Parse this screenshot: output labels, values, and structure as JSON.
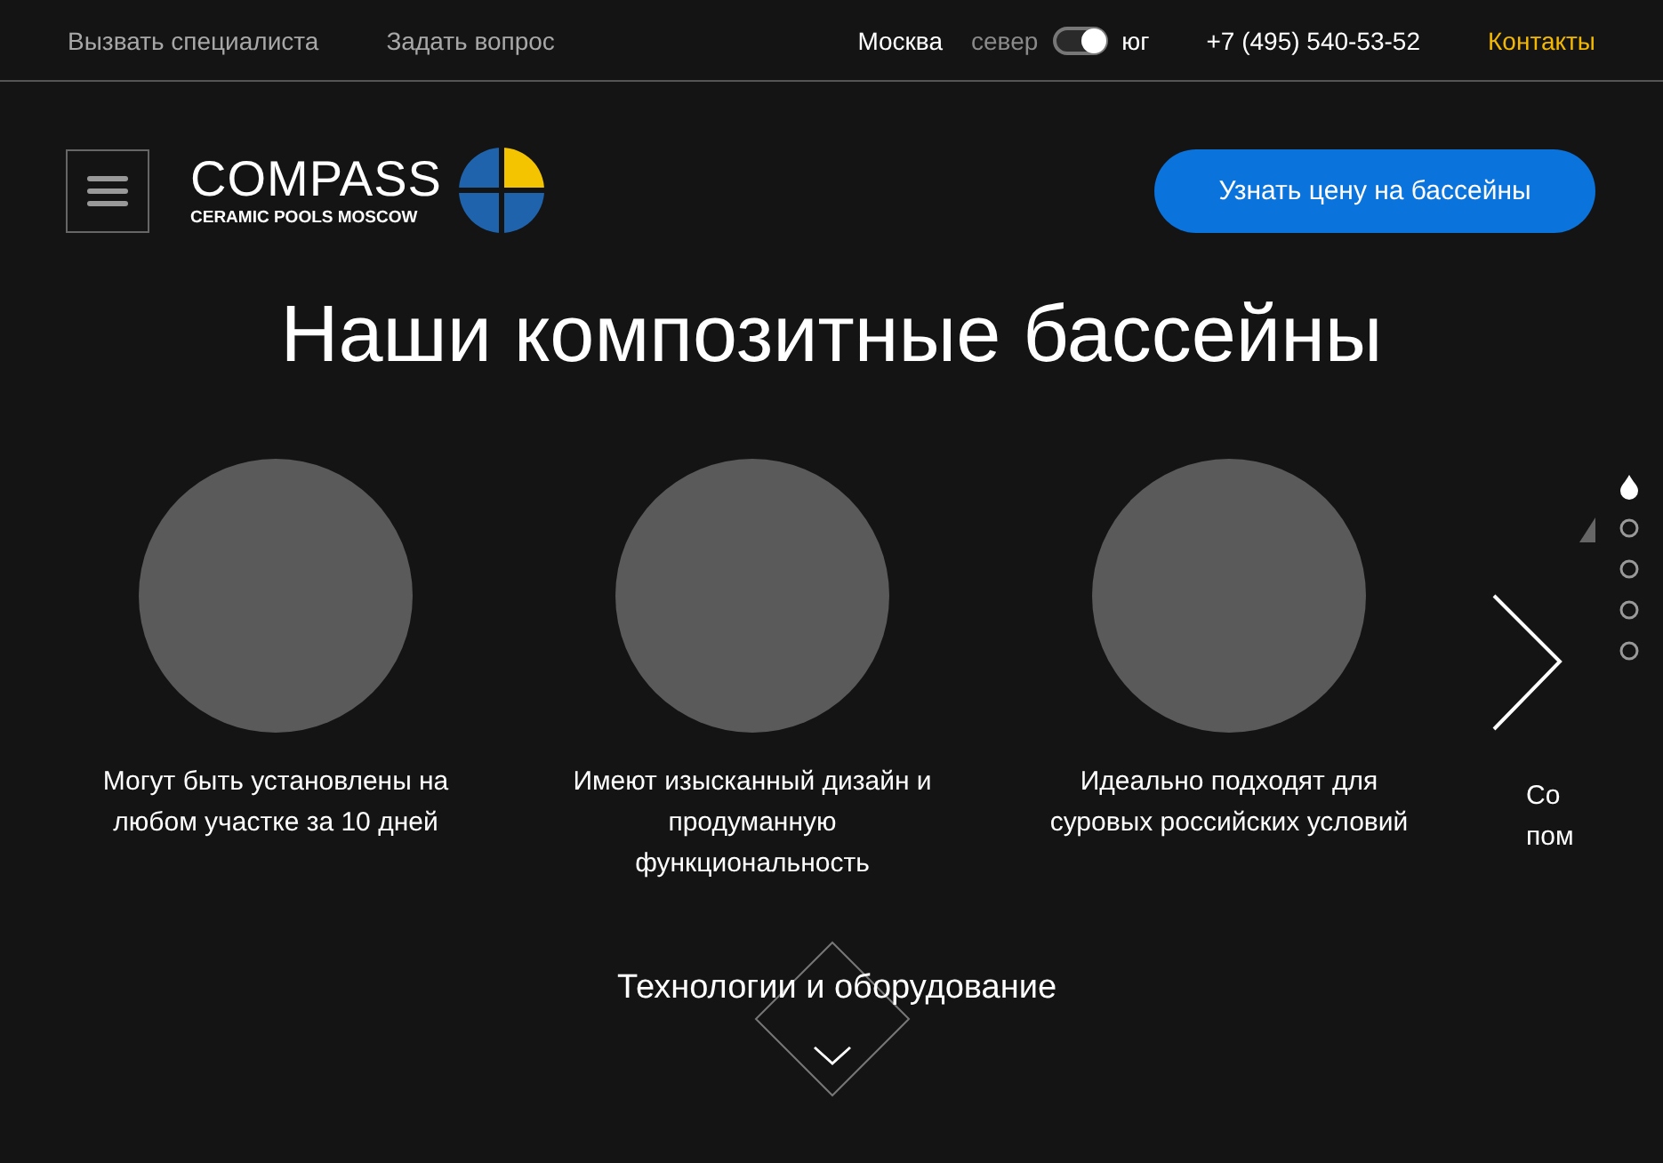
{
  "top_bar": {
    "links": [
      "Вызвать специалиста",
      "Задать вопрос"
    ],
    "city": "Москва",
    "region_toggle": {
      "left_label": "север",
      "right_label": "юг",
      "on": true
    },
    "phone": "+7 (495) 540-53-52",
    "contacts_link": "Контакты"
  },
  "header": {
    "logo": {
      "name": "COMPASS",
      "tagline": "CERAMIC POOLS MOSCOW"
    },
    "cta_button": "Узнать цену на бассейны"
  },
  "title": "Наши композитные бассейны",
  "features": [
    {
      "kind": "full",
      "lines": [
        "Могут быть установлены на",
        "любом участке за 10 дней"
      ]
    },
    {
      "kind": "full",
      "lines": [
        "Имеют изысканный дизайн и",
        "продуманную",
        "функциональность"
      ]
    },
    {
      "kind": "full",
      "lines": [
        "Идеально подходят для",
        "суровых российских условий"
      ]
    },
    {
      "kind": "peek",
      "lines": [
        "Со",
        "пом"
      ]
    }
  ],
  "pager": [
    {
      "selected": true
    },
    {
      "selected": false
    },
    {
      "selected": false
    },
    {
      "selected": false
    },
    {
      "selected": false
    }
  ],
  "next_section": "Технологии и оборудование"
}
